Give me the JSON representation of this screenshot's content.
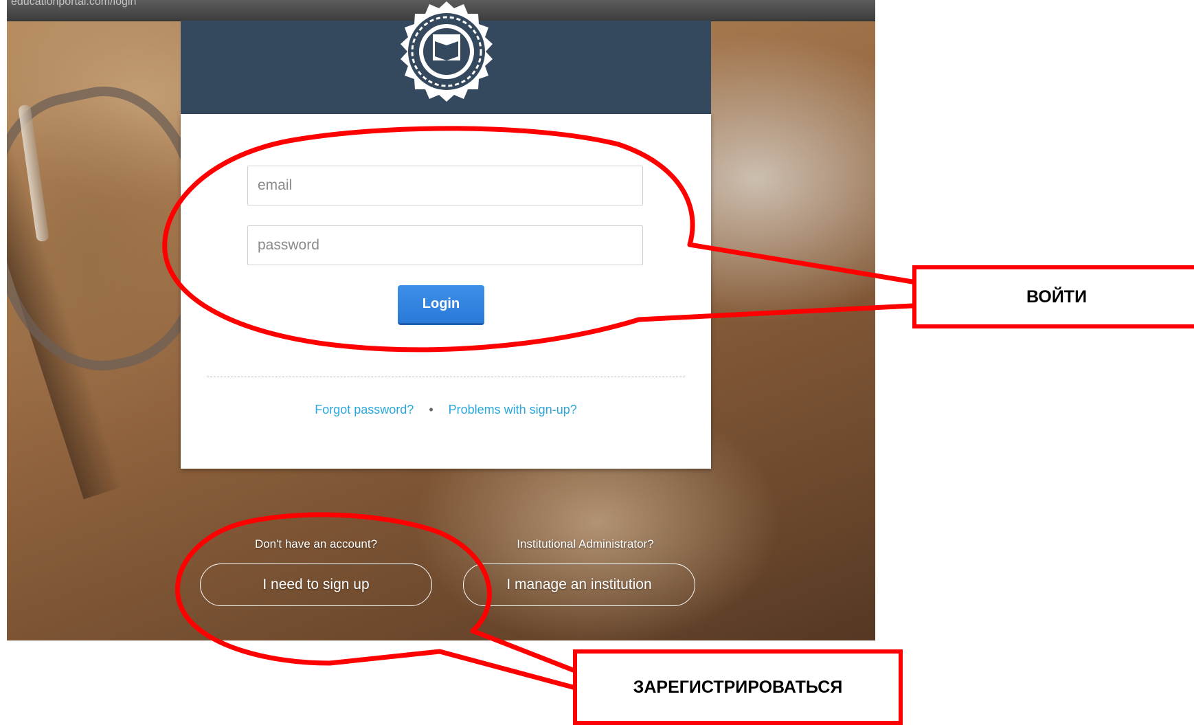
{
  "browser": {
    "address": "educationportal.com/login"
  },
  "login_form": {
    "email_placeholder": "email",
    "password_placeholder": "password",
    "login_label": "Login"
  },
  "help_links": {
    "forgot_password": "Forgot password?",
    "separator": "•",
    "signup_problems": "Problems with sign-up?"
  },
  "signup": {
    "prompt": "Don't have an account?",
    "button_label": "I need to sign up"
  },
  "institution": {
    "prompt": "Institutional Administrator?",
    "button_label": "I manage an institution"
  },
  "annotations": {
    "login_callout": "ВОЙТИ",
    "signup_callout": "ЗАРЕГИСТРИРОВАТЬСЯ",
    "color": "#ff0000"
  },
  "colors": {
    "header_bg": "#34495e",
    "login_button": "#2a79d8",
    "link": "#2aa7dc"
  }
}
